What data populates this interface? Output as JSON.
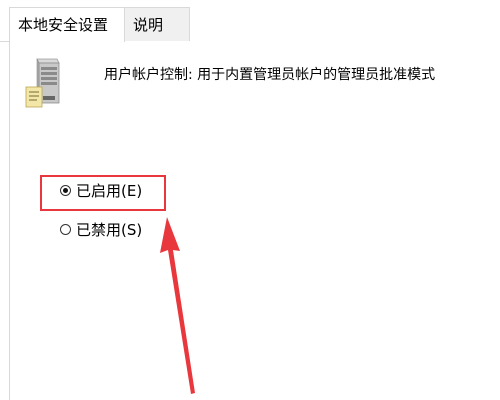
{
  "tabs": [
    {
      "label": "本地安全设置",
      "active": true
    },
    {
      "label": "说明",
      "active": false
    }
  ],
  "policy": {
    "icon": "server-icon",
    "title": "用户帐户控制: 用于内置管理员帐户的管理员批准模式"
  },
  "options": [
    {
      "label": "已启用(E)",
      "checked": true
    },
    {
      "label": "已禁用(S)",
      "checked": false
    }
  ],
  "annotation": {
    "highlight_color": "#e8383d",
    "arrow_color": "#e8383d"
  }
}
